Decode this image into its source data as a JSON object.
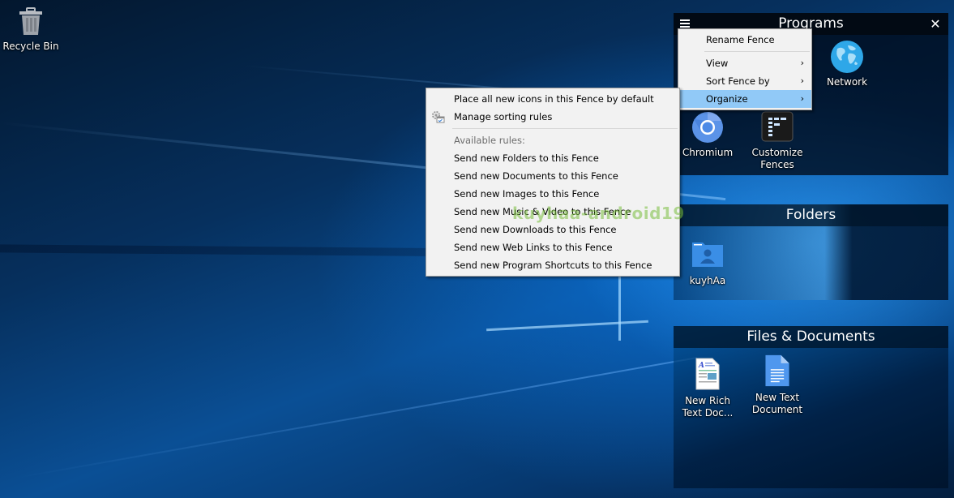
{
  "desktop": {
    "icons": [
      {
        "label": "Recycle Bin",
        "icon": "recycle-bin-icon"
      }
    ]
  },
  "fences": {
    "programs": {
      "title": "Programs",
      "menu_icon": "hamburger-icon",
      "close_icon": "close-icon",
      "close_glyph": "✕",
      "items": [
        {
          "label": "Network",
          "icon": "network-globe-icon"
        },
        {
          "label": "Chromium",
          "icon": "chromium-icon"
        },
        {
          "label": "Customize Fences",
          "line1": "Customize",
          "line2": "Fences",
          "icon": "fences-app-icon"
        }
      ]
    },
    "folders": {
      "title": "Folders",
      "items": [
        {
          "label": "kuyhAa",
          "icon": "user-folder-icon"
        }
      ]
    },
    "files": {
      "title": "Files & Documents",
      "items": [
        {
          "label": "New Rich Text Doc...",
          "line1": "New Rich",
          "line2": "Text Doc...",
          "icon": "rich-text-document-icon"
        },
        {
          "label": "New Text Document",
          "line1": "New Text",
          "line2": "Document",
          "icon": "text-document-icon"
        }
      ]
    }
  },
  "fence_menu": {
    "items": [
      {
        "label": "Rename Fence",
        "submenu": false
      },
      {
        "label": "View",
        "submenu": true
      },
      {
        "label": "Sort Fence by",
        "submenu": true
      },
      {
        "label": "Organize",
        "submenu": true,
        "highlighted": true
      }
    ],
    "submenu_arrow": "›"
  },
  "organize_menu": {
    "top_items": [
      {
        "label": "Place all new icons in this Fence by default"
      },
      {
        "label": "Manage sorting rules",
        "icon": "manage-rules-icon"
      }
    ],
    "section_header": "Available rules:",
    "rules": [
      "Send new Folders to this Fence",
      "Send new Documents to this Fence",
      "Send new Images to this Fence",
      "Send new Music & Video to this Fence",
      "Send new Downloads to this Fence",
      "Send new Web Links to this Fence",
      "Send new Program Shortcuts to this Fence"
    ]
  },
  "watermark": "kuyhaa-android19",
  "colors": {
    "menu_bg": "#f2f2f2",
    "menu_highlight": "#91c9f7",
    "disabled_text": "#6d6d6d",
    "fence_header": "#020a14"
  }
}
